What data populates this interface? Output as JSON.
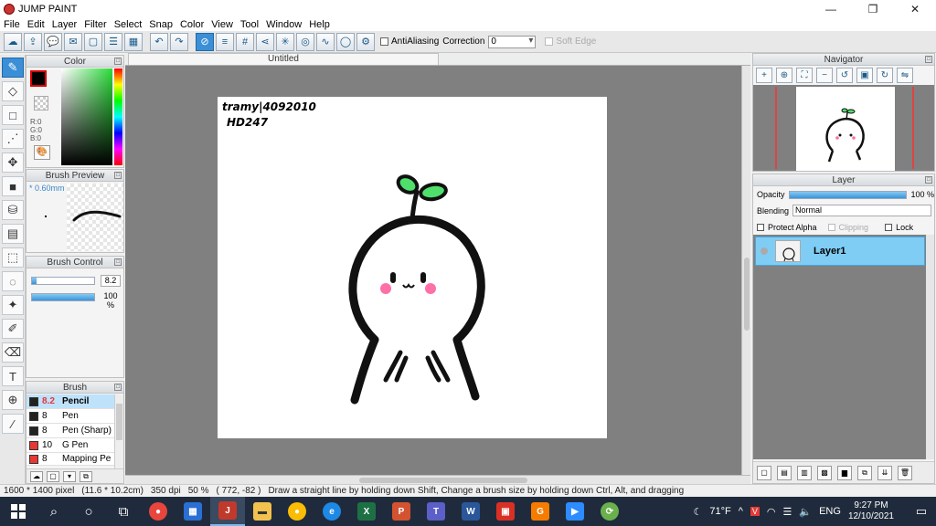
{
  "window": {
    "title": "JUMP PAINT",
    "minimize": "—",
    "maximize": "❐",
    "close": "✕"
  },
  "menu": [
    "File",
    "Edit",
    "Layer",
    "Filter",
    "Select",
    "Snap",
    "Color",
    "View",
    "Tool",
    "Window",
    "Help"
  ],
  "toolbar": {
    "antialiasing_label": "AntiAliasing",
    "correction_label": "Correction",
    "correction_value": "0",
    "soft_edge_label": "Soft Edge"
  },
  "color_panel": {
    "title": "Color",
    "r": "R:0",
    "g": "G:0",
    "b": "B:0",
    "foreground": "#000000"
  },
  "brush_preview": {
    "title": "Brush Preview",
    "size": "* 0.60mm"
  },
  "brush_control": {
    "title": "Brush Control",
    "size_value": "8.2",
    "size_fraction": 0.08,
    "opacity_value": "100 %",
    "opacity_fraction": 1.0
  },
  "brush": {
    "title": "Brush",
    "items": [
      {
        "size": "8.2",
        "name": "Pencil",
        "color": "#222222"
      },
      {
        "size": "8",
        "name": "Pen",
        "color": "#222222"
      },
      {
        "size": "8",
        "name": "Pen (Sharp)",
        "color": "#222222"
      },
      {
        "size": "10",
        "name": "G Pen",
        "color": "#e53935"
      },
      {
        "size": "8",
        "name": "Mapping Pe",
        "color": "#e53935"
      }
    ]
  },
  "document": {
    "tab_title": "Untitled",
    "handwriting_line1": "tramy|4092010",
    "handwriting_line2": "HD247"
  },
  "navigator": {
    "title": "Navigator"
  },
  "layer_panel": {
    "title": "Layer",
    "opacity_label": "Opacity",
    "opacity_value": "100 %",
    "blending_label": "Blending",
    "blending_value": "Normal",
    "protect_alpha": "Protect Alpha",
    "clipping": "Clipping",
    "lock": "Lock",
    "layers": [
      {
        "name": "Layer1"
      }
    ]
  },
  "status": {
    "size": "1600 * 1400 pixel",
    "physical": "(11.6 * 10.2cm)",
    "dpi": "350 dpi",
    "zoom": "50 %",
    "coords": "( 772, -82 )",
    "hint": "Draw a straight line by holding down Shift, Change a brush size by holding down Ctrl, Alt, and dragging"
  },
  "taskbar": {
    "weather": "71°F",
    "language": "ENG",
    "time": "9:27 PM",
    "date": "12/10/2021"
  }
}
